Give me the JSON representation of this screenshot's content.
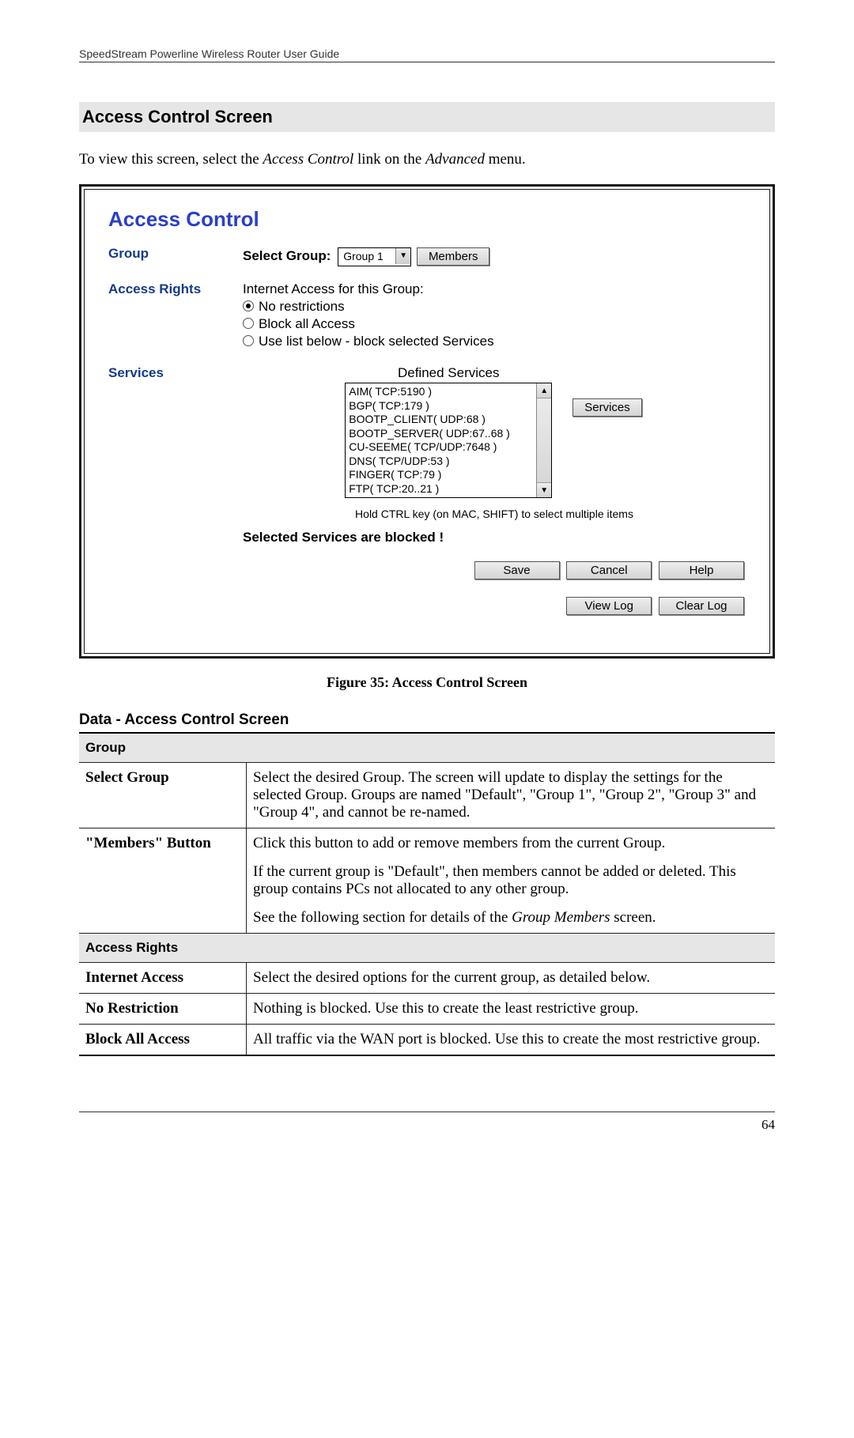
{
  "header": "SpeedStream Powerline Wireless Router User Guide",
  "section_title": "Access Control Screen",
  "intro": {
    "pre": "To view this screen, select the ",
    "link1": "Access Control",
    "mid": " link on the ",
    "link2": "Advanced",
    "post": " menu."
  },
  "embed": {
    "title": "Access Control",
    "labels": {
      "group": "Group",
      "access_rights": "Access Rights",
      "services": "Services"
    },
    "select_group_label": "Select Group:",
    "select_group_value": "Group 1",
    "members_btn": "Members",
    "access_header": "Internet Access for this Group:",
    "radios": [
      "No restrictions",
      "Block all Access",
      "Use list below - block selected Services"
    ],
    "radio_selected": 0,
    "services_title": "Defined Services",
    "services_btn": "Services",
    "service_items": [
      "AIM( TCP:5190 )",
      "BGP( TCP:179 )",
      "BOOTP_CLIENT( UDP:68 )",
      "BOOTP_SERVER( UDP:67..68 )",
      "CU-SEEME( TCP/UDP:7648 )",
      "DNS( TCP/UDP:53 )",
      "FINGER( TCP:79 )",
      "FTP( TCP:20..21 )"
    ],
    "hint": "Hold CTRL key (on MAC, SHIFT) to select multiple items",
    "blocked_msg": "Selected Services are blocked !",
    "buttons": {
      "save": "Save",
      "cancel": "Cancel",
      "help": "Help",
      "viewlog": "View Log",
      "clearlog": "Clear Log"
    }
  },
  "figure_caption": "Figure 35: Access Control Screen",
  "data_header": "Data - Access Control Screen",
  "table": {
    "sect_group": "Group",
    "row_select_group": {
      "label": "Select Group",
      "desc": "Select the desired Group. The screen will update to display the settings for the selected Group. Groups are named \"Default\", \"Group 1\", \"Group 2\", \"Group 3\" and \"Group 4\", and cannot be re-named."
    },
    "row_members": {
      "label": "\"Members\" Button",
      "p1": "Click this button to add or remove members from the current Group.",
      "p2": "If the current group is \"Default\", then members cannot be added or deleted. This group contains PCs not allocated to any other group.",
      "p3_pre": "See the following section for details of the ",
      "p3_em": "Group Members",
      "p3_post": " screen."
    },
    "sect_access": "Access Rights",
    "row_internet": {
      "label": "Internet Access",
      "desc": "Select the desired options for the current group, as detailed below."
    },
    "row_norestrict": {
      "label": "No Restriction",
      "desc": "Nothing is blocked. Use this to create the least restrictive group."
    },
    "row_blockall": {
      "label": "Block All Access",
      "desc": "All traffic via the WAN port is blocked. Use this to create the most restrictive group."
    }
  },
  "page_number": "64"
}
